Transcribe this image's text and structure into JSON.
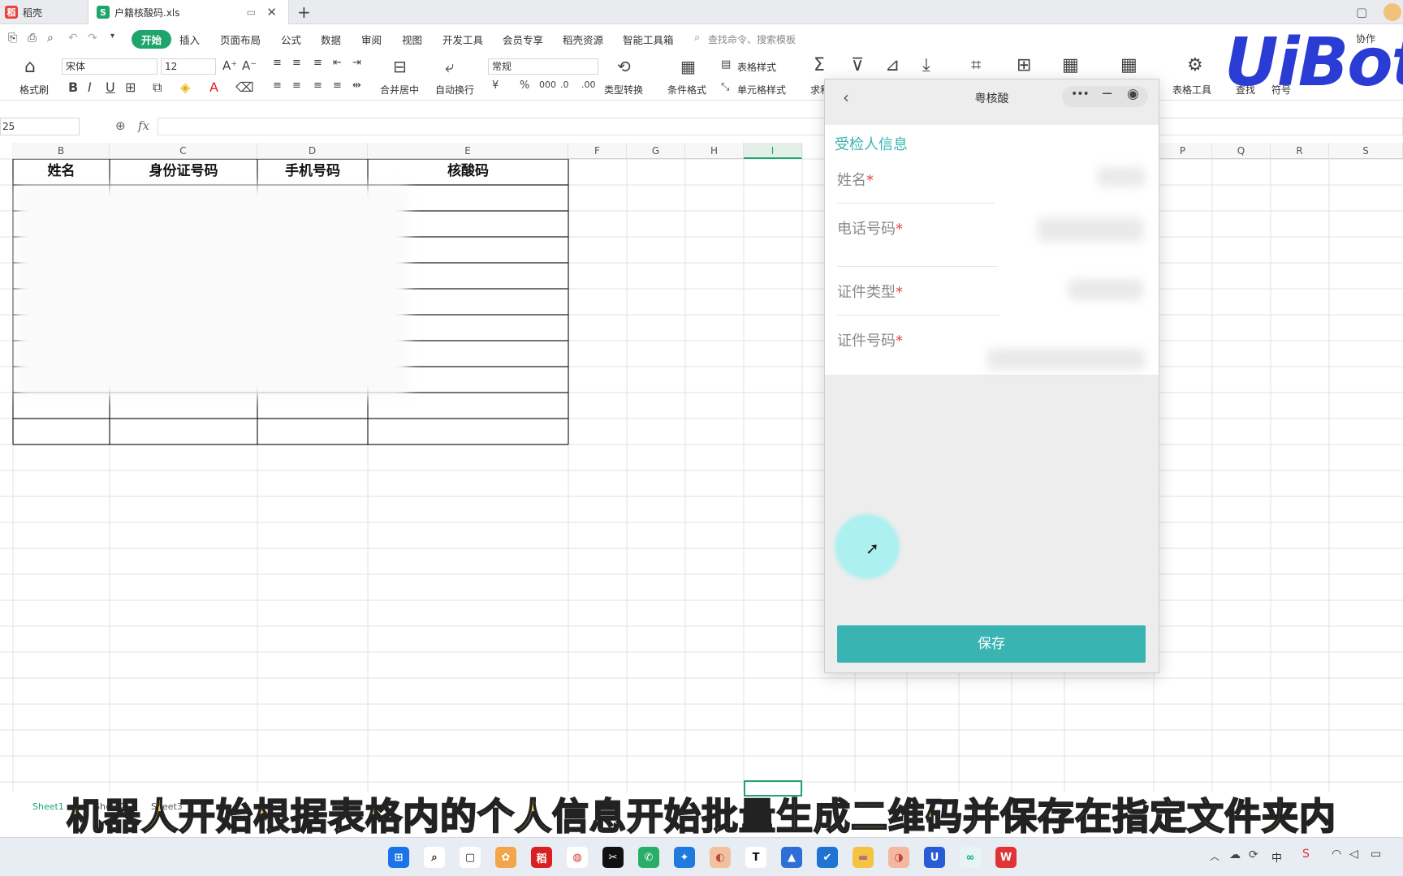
{
  "tabs": [
    {
      "label": "稻壳",
      "active": false
    },
    {
      "label": "户籍核酸码.xls",
      "active": true
    }
  ],
  "menu": {
    "items": [
      "开始",
      "插入",
      "页面布局",
      "公式",
      "数据",
      "审阅",
      "视图",
      "开发工具",
      "会员专享",
      "稻壳资源",
      "智能工具箱"
    ],
    "search_placeholder": "查找命令、搜索模板",
    "collab": "协作"
  },
  "ribbon": {
    "format_painter": "格式刷",
    "font_name": "宋体",
    "font_size": "12",
    "merge_center": "合并居中",
    "auto_wrap": "自动换行",
    "number_format": "常规",
    "type_convert": "类型转换",
    "cond_format": "条件格式",
    "table_style": "表格样式",
    "cell_style": "单元格样式",
    "sum": "求和",
    "table_tools": "表格工具",
    "find": "查找",
    "symbol": "符号"
  },
  "formula_bar": {
    "cell_ref": "25",
    "fx": "fx"
  },
  "columns": [
    "B",
    "C",
    "D",
    "E",
    "F",
    "G",
    "H",
    "I",
    "P",
    "Q",
    "R",
    "S"
  ],
  "table_headers": [
    "姓名",
    "身份证号码",
    "手机号码",
    "核酸码"
  ],
  "panel": {
    "title": "粤核酸",
    "section": "受检人信息",
    "fields": [
      "姓名",
      "电话号码",
      "证件类型",
      "证件号码"
    ],
    "required_mark": "*",
    "save": "保存"
  },
  "sheet_tabs": [
    "Sheet1",
    "Sheet2",
    "Sheet3"
  ],
  "subtitle": "机器人开始根据表格内的个人信息开始批量生成二维码并保存在指定文件夹内",
  "watermark": "UiBot",
  "taskbar": {
    "icons": [
      "windows-start",
      "search",
      "task-view",
      "app-1",
      "app-wps",
      "chrome",
      "capcut",
      "wechat",
      "app-2",
      "app-3",
      "typora",
      "app-4",
      "app-5",
      "file-explorer",
      "app-6",
      "uibot",
      "app-7",
      "wps-office"
    ],
    "tray_ime": "中"
  },
  "colors": {
    "accent_green": "#1fa56b",
    "panel_teal": "#3ab4b2",
    "subtitle_yellow": "#f6c85f",
    "uibot_blue": "#2a3cd4"
  }
}
